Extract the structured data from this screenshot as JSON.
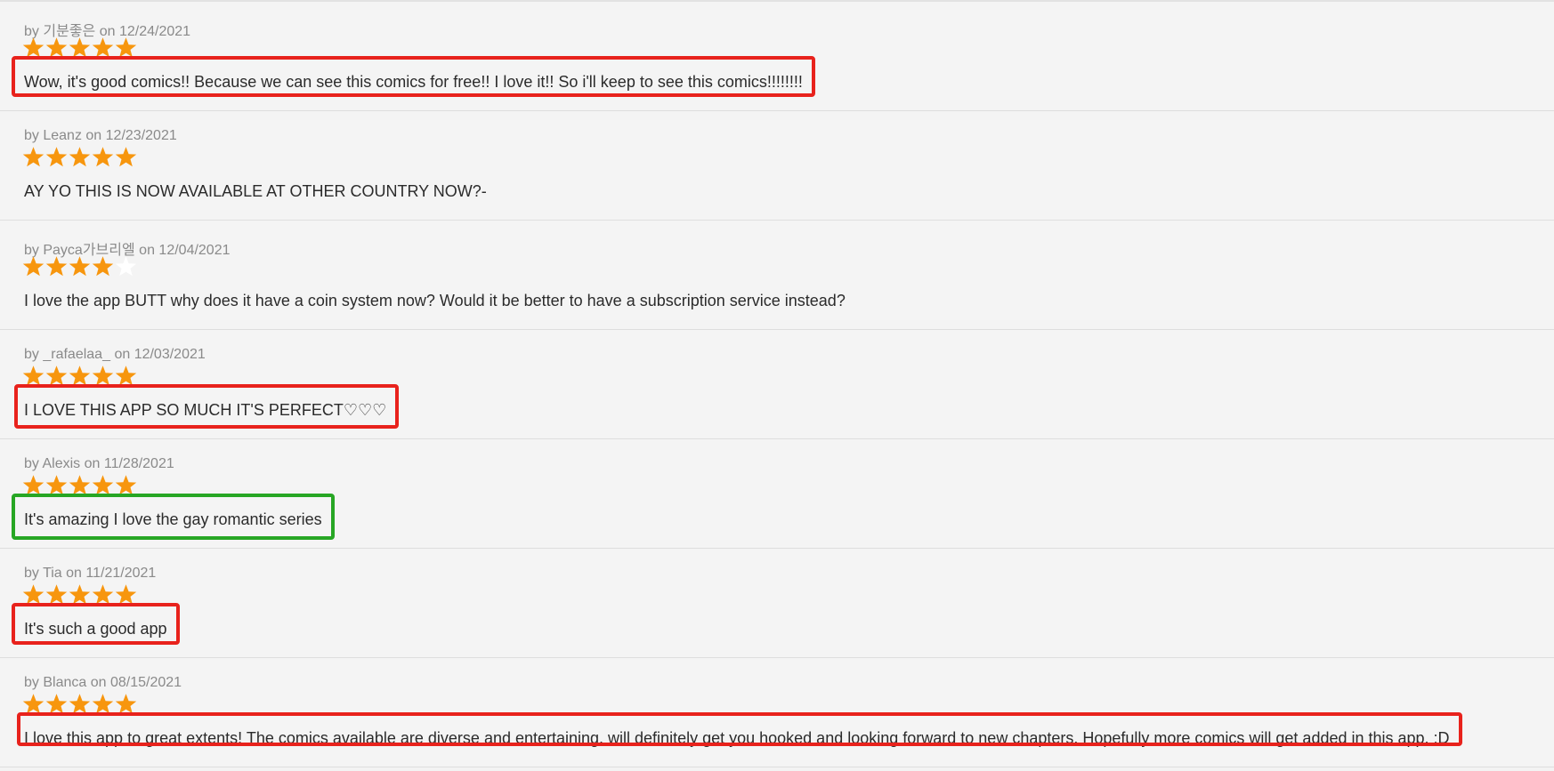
{
  "colors": {
    "star_filled": "#f7960e",
    "star_empty": "#ffffff",
    "highlight_red": "#e8221c",
    "highlight_green": "#27a624"
  },
  "labels": {
    "by": "by",
    "on": "on"
  },
  "reviews": [
    {
      "author": "기분좋은",
      "date": "12/24/2021",
      "rating": 5,
      "text": "Wow, it's good comics!! Because we can see this comics for free!! I love it!! So i'll keep to see this comics!!!!!!!!",
      "highlight": "red"
    },
    {
      "author": "Leanz",
      "date": "12/23/2021",
      "rating": 5,
      "text": "AY YO THIS IS NOW AVAILABLE AT OTHER COUNTRY NOW?-",
      "highlight": "none"
    },
    {
      "author": "Payca가브리엘",
      "date": "12/04/2021",
      "rating": 4,
      "text": "I love the app BUTT why does it have a coin system now? Would it be better to have a subscription service instead?",
      "highlight": "none"
    },
    {
      "author": "_rafaelaa_",
      "date": "12/03/2021",
      "rating": 5,
      "text": "I LOVE THIS APP SO MUCH IT'S PERFECT♡♡♡",
      "highlight": "red"
    },
    {
      "author": "Alexis",
      "date": "11/28/2021",
      "rating": 5,
      "text": "It's amazing I love the gay romantic series",
      "highlight": "green"
    },
    {
      "author": "Tia",
      "date": "11/21/2021",
      "rating": 5,
      "text": "It's such a good app",
      "highlight": "red"
    },
    {
      "author": "Blanca",
      "date": "08/15/2021",
      "rating": 5,
      "text": "I love this app to great extents! The comics available are diverse and entertaining, will definitely get you hooked and looking forward to new chapters. Hopefully more comics will get added in this app. :D",
      "highlight": "red"
    }
  ]
}
